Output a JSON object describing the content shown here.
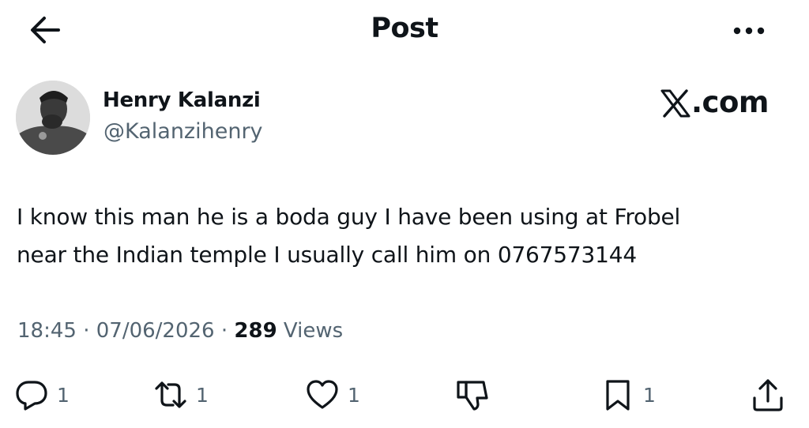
{
  "header": {
    "title": "Post",
    "back_icon": "arrow-left-icon",
    "more_icon": "more-horizontal-icon"
  },
  "author": {
    "name": "Henry Kalanzi",
    "handle": "@Kalanzihenry"
  },
  "brand": {
    "text": ".com",
    "logo_icon": "x-logo-icon"
  },
  "post": {
    "lines": [
      "I know this man he is a boda guy I have been using at Frobel",
      "near the Indian temple I usually call him on 0767573144"
    ]
  },
  "meta": {
    "time": "18:45",
    "separator": " · ",
    "date": "07/06/2026",
    "views_count": "289",
    "views_label": " Views"
  },
  "actions": {
    "reply": {
      "icon": "reply-icon",
      "count": "1"
    },
    "repost": {
      "icon": "repost-icon",
      "count": "1"
    },
    "like": {
      "icon": "heart-icon",
      "count": "1"
    },
    "dislike": {
      "icon": "thumbs-down-icon"
    },
    "bookmark": {
      "icon": "bookmark-icon",
      "count": "1"
    },
    "share": {
      "icon": "share-icon"
    }
  },
  "colors": {
    "text_primary": "#0f1419",
    "text_secondary": "#536471",
    "background": "#ffffff"
  }
}
